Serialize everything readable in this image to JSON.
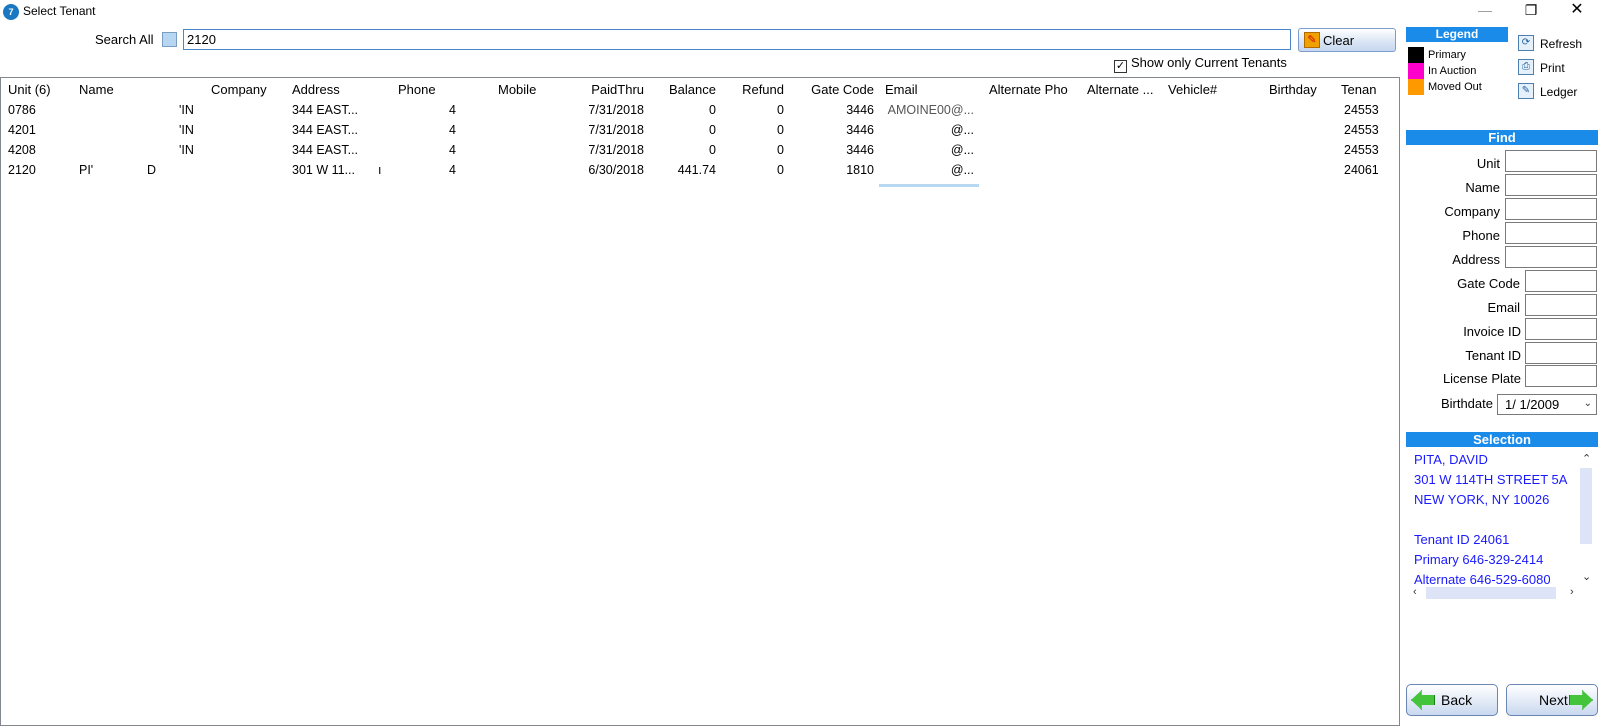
{
  "window": {
    "title": "Select Tenant",
    "icon_text": "7",
    "minimize": "—",
    "maximize": "❐",
    "close": "✕"
  },
  "search": {
    "label": "Search All",
    "value": "2120",
    "clear_label": "Clear",
    "show_current_label": "Show only Current Tenants",
    "show_current_checked": "✓"
  },
  "grid": {
    "columns": [
      "Unit (6)",
      "Name",
      "Company",
      "Address",
      "Phone",
      "Mobile",
      "PaidThru",
      "Balance",
      "Refund",
      "Gate Code",
      "Email",
      "Alternate Pho",
      "Alternate ...",
      "Vehicle#",
      "Birthday",
      "Tenan"
    ],
    "rows": [
      {
        "unit": "0786",
        "name": "",
        "name2": "'IN",
        "company": "",
        "address": "344 EAST...",
        "addr_mark": "",
        "phone": "4",
        "mobile": "",
        "paidthru": "7/31/2018",
        "balance": "0",
        "refund": "0",
        "gate": "3446",
        "email": "AMOINE00@...",
        "alt_phone": "",
        "alt": "",
        "vehicle": "",
        "birthday": "",
        "tenant": "24553"
      },
      {
        "unit": "4201",
        "name": "",
        "name2": "'IN",
        "company": "",
        "address": "344 EAST...",
        "addr_mark": "",
        "phone": "4",
        "mobile": "",
        "paidthru": "7/31/2018",
        "balance": "0",
        "refund": "0",
        "gate": "3446",
        "email": "@...",
        "alt_phone": "",
        "alt": "",
        "vehicle": "",
        "birthday": "",
        "tenant": "24553"
      },
      {
        "unit": "4208",
        "name": "",
        "name2": "'IN",
        "company": "",
        "address": "344 EAST...",
        "addr_mark": "",
        "phone": "4",
        "mobile": "",
        "paidthru": "7/31/2018",
        "balance": "0",
        "refund": "0",
        "gate": "3446",
        "email": "@...",
        "alt_phone": "",
        "alt": "",
        "vehicle": "",
        "birthday": "",
        "tenant": "24553"
      },
      {
        "unit": "2120",
        "name": "PI'",
        "name2": "D",
        "company": "",
        "address": "301 W 11...",
        "addr_mark": "ı",
        "phone": "4",
        "mobile": "",
        "paidthru": "6/30/2018",
        "balance": "441.74",
        "refund": "0",
        "gate": "1810",
        "email": "@...",
        "alt_phone": "",
        "alt": "",
        "vehicle": "",
        "birthday": "",
        "tenant": "24061"
      }
    ]
  },
  "legend": {
    "title": "Legend",
    "items": [
      {
        "label": "Primary",
        "color": "#000000"
      },
      {
        "label": "In Auction",
        "color": "#ff00cc"
      },
      {
        "label": "Moved Out",
        "color": "#ff9900"
      }
    ]
  },
  "toolbar": {
    "refresh": "Refresh",
    "print": "Print",
    "ledger": "Ledger"
  },
  "find": {
    "title": "Find",
    "fields": [
      "Unit",
      "Name",
      "Company",
      "Phone",
      "Address",
      "Gate Code",
      "Email",
      "Invoice ID",
      "Tenant ID",
      "License Plate"
    ],
    "birthdate_label": "Birthdate",
    "birthdate_value": "1/  1/2009"
  },
  "selection": {
    "title": "Selection",
    "lines": [
      "PITA, DAVID",
      "301 W 114TH STREET 5A",
      "NEW YORK, NY  10026",
      "",
      "Tenant ID   24061",
      "Primary   646-329-2414",
      "Alternate   646-529-6080"
    ]
  },
  "nav": {
    "back": "Back",
    "next": "Next"
  }
}
